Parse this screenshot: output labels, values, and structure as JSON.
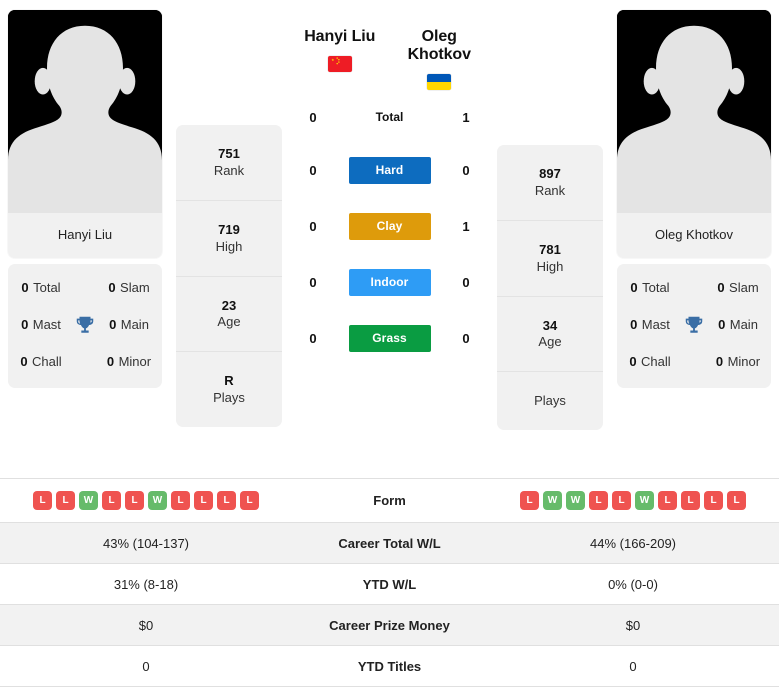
{
  "players": {
    "left": {
      "name": "Hanyi Liu",
      "photo_caption": "Hanyi Liu",
      "flag": "cn-flag-icon",
      "rank": "751",
      "rank_label": "Rank",
      "high": "719",
      "high_label": "High",
      "age": "23",
      "age_label": "Age",
      "plays": "R",
      "plays_label": "Plays",
      "titles": {
        "total": "0",
        "total_label": "Total",
        "slam": "0",
        "slam_label": "Slam",
        "mast": "0",
        "mast_label": "Mast",
        "main": "0",
        "main_label": "Main",
        "chall": "0",
        "chall_label": "Chall",
        "minor": "0",
        "minor_label": "Minor"
      },
      "form": [
        "L",
        "L",
        "W",
        "L",
        "L",
        "W",
        "L",
        "L",
        "L",
        "L"
      ],
      "career_total_wl": "43% (104-137)",
      "ytd_wl": "31% (8-18)",
      "career_prize_money": "$0",
      "ytd_titles": "0"
    },
    "right": {
      "name": "Oleg Khotkov",
      "photo_caption": "Oleg Khotkov",
      "flag": "ua-flag-icon",
      "rank": "897",
      "rank_label": "Rank",
      "high": "781",
      "high_label": "High",
      "age": "34",
      "age_label": "Age",
      "plays": "",
      "plays_label": "Plays",
      "titles": {
        "total": "0",
        "total_label": "Total",
        "slam": "0",
        "slam_label": "Slam",
        "mast": "0",
        "mast_label": "Mast",
        "main": "0",
        "main_label": "Main",
        "chall": "0",
        "chall_label": "Chall",
        "minor": "0",
        "minor_label": "Minor"
      },
      "form": [
        "L",
        "W",
        "W",
        "L",
        "L",
        "W",
        "L",
        "L",
        "L",
        "L"
      ],
      "career_total_wl": "44% (166-209)",
      "ytd_wl": "0% (0-0)",
      "career_prize_money": "$0",
      "ytd_titles": "0"
    }
  },
  "h2h": [
    {
      "label": "Total",
      "left": "0",
      "right": "1",
      "color": ""
    },
    {
      "label": "Hard",
      "left": "0",
      "right": "0",
      "color": "#0d6cbf"
    },
    {
      "label": "Clay",
      "left": "0",
      "right": "1",
      "color": "#de9b0b"
    },
    {
      "label": "Indoor",
      "left": "0",
      "right": "0",
      "color": "#2e9cf5"
    },
    {
      "label": "Grass",
      "left": "0",
      "right": "0",
      "color": "#0a9c42"
    }
  ],
  "table_rows": [
    {
      "label": "Form",
      "left": "",
      "right": "",
      "kind": "form",
      "shaded": false
    },
    {
      "label": "Career Total W/L",
      "left": "43% (104-137)",
      "right": "44% (166-209)",
      "kind": "text",
      "shaded": true
    },
    {
      "label": "YTD W/L",
      "left": "31% (8-18)",
      "right": "0% (0-0)",
      "kind": "text",
      "shaded": false
    },
    {
      "label": "Career Prize Money",
      "left": "$0",
      "right": "$0",
      "kind": "text",
      "shaded": true
    },
    {
      "label": "YTD Titles",
      "left": "0",
      "right": "0",
      "kind": "text",
      "shaded": false
    }
  ],
  "colors": {
    "win_badge": "#66bb6a",
    "loss_badge": "#ef5350",
    "hard": "#0d6cbf",
    "clay": "#de9b0b",
    "indoor": "#2e9cf5",
    "grass": "#0a9c42",
    "trophy": "#3a6ea5",
    "card_bg": "#f1f1f1"
  }
}
